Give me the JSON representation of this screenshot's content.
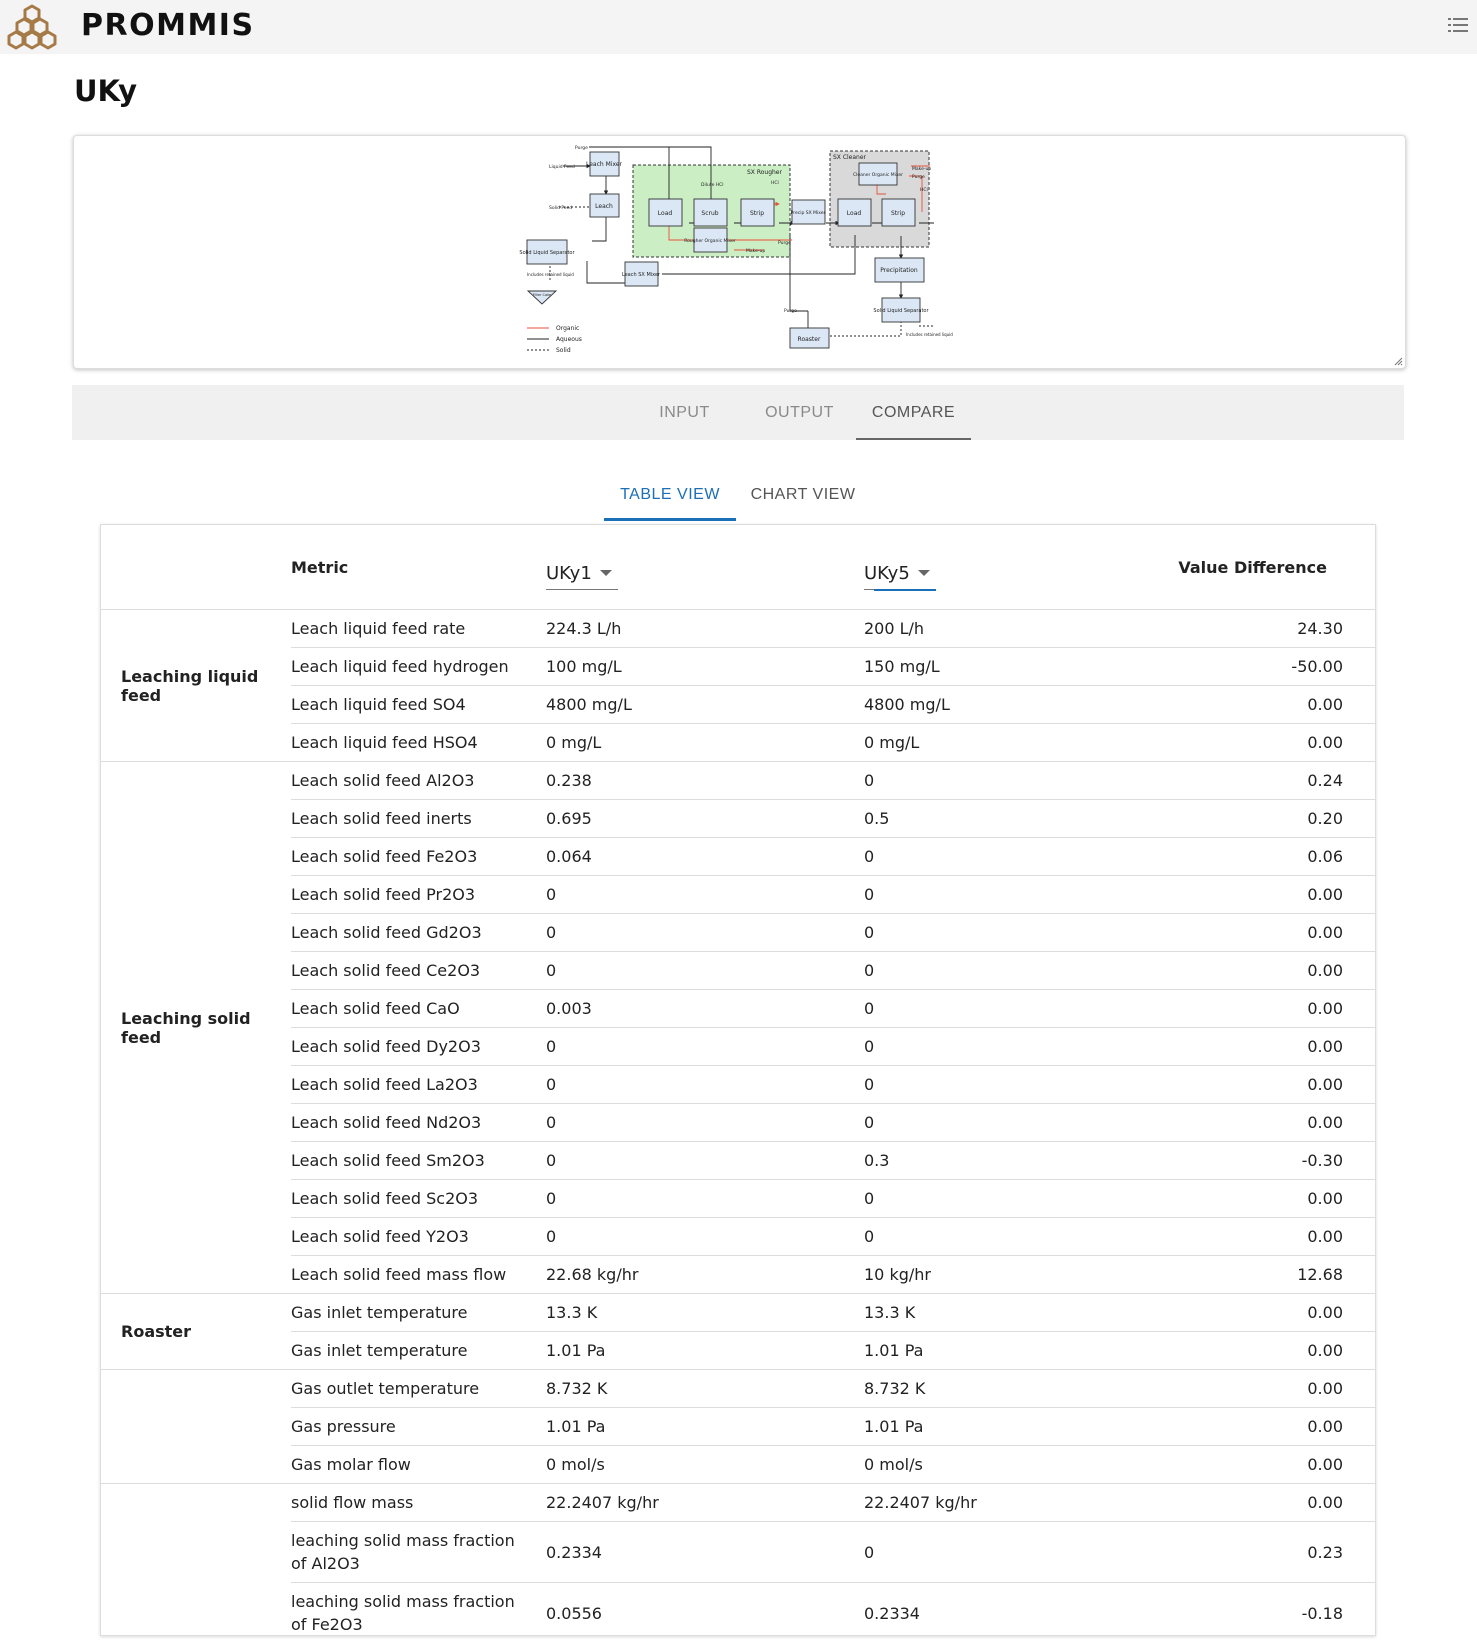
{
  "app": {
    "brand": "PROMMIS"
  },
  "page": {
    "title": "UKy"
  },
  "diagram": {
    "labels": {
      "purge": "Purge",
      "liquid_feed": "Liquid Feed",
      "solid_feed": "Solid Feed",
      "leach_mixer": "Leach Mixer",
      "leach": "Leach",
      "solid_liquid_separator": "Solid Liquid Separator",
      "includes_retained_liquid": "Includes retained liquid",
      "filter_cake": "Filter Cake",
      "sx_rougher": "SX Rougher",
      "dilute_hcl": "Dilute HCl",
      "hcl": "HCl",
      "load": "Load",
      "scrub": "Scrub",
      "strip": "Strip",
      "rougher_organic_mixer": "Rougher Organic Mixer",
      "makeup": "Make-up",
      "leach_sx_mixer": "Leach SX Mixer",
      "precip_sx_mixer": "Precip SX Mixer",
      "sx_cleaner": "SX Cleaner",
      "cleaner_organic_mixer": "Cleaner Organic Mixer",
      "precipitation": "Precipitation",
      "roaster": "Roaster",
      "legend_organic": "Organic",
      "legend_aqueous": "Aqueous",
      "legend_solid": "Solid"
    },
    "colors": {
      "organic": "#e8513a",
      "aqueous": "#222222",
      "rougher_bg": "#cbeec5",
      "cleaner_bg": "#d9d9d9",
      "unit_fill": "#dbe7f5"
    }
  },
  "tabs": {
    "input": "INPUT",
    "output": "OUTPUT",
    "compare": "COMPARE",
    "active": "COMPARE"
  },
  "view_tabs": {
    "table": "TABLE VIEW",
    "chart": "CHART VIEW",
    "active": "TABLE VIEW"
  },
  "table": {
    "header": {
      "metric": "Metric",
      "left_scenario": "UKy1",
      "right_scenario": "UKy5",
      "diff": "Value Difference"
    },
    "groups": [
      {
        "name": "Leaching liquid feed",
        "rows": [
          {
            "metric": "Leach liquid feed rate",
            "left": "224.3 L/h",
            "right": "200 L/h",
            "diff": "24.30"
          },
          {
            "metric": "Leach liquid feed hydrogen",
            "left": "100 mg/L",
            "right": "150 mg/L",
            "diff": "-50.00"
          },
          {
            "metric": "Leach liquid feed SO4",
            "left": "4800 mg/L",
            "right": "4800 mg/L",
            "diff": "0.00"
          },
          {
            "metric": "Leach liquid feed HSO4",
            "left": "0 mg/L",
            "right": "0 mg/L",
            "diff": "0.00"
          }
        ]
      },
      {
        "name": "Leaching solid feed",
        "rows": [
          {
            "metric": "Leach solid feed Al2O3",
            "left": "0.238",
            "right": "0",
            "diff": "0.24"
          },
          {
            "metric": "Leach solid feed inerts",
            "left": "0.695",
            "right": "0.5",
            "diff": "0.20"
          },
          {
            "metric": "Leach solid feed Fe2O3",
            "left": "0.064",
            "right": "0",
            "diff": "0.06"
          },
          {
            "metric": "Leach solid feed Pr2O3",
            "left": "0",
            "right": "0",
            "diff": "0.00"
          },
          {
            "metric": "Leach solid feed Gd2O3",
            "left": "0",
            "right": "0",
            "diff": "0.00"
          },
          {
            "metric": "Leach solid feed Ce2O3",
            "left": "0",
            "right": "0",
            "diff": "0.00"
          },
          {
            "metric": "Leach solid feed CaO",
            "left": "0.003",
            "right": "0",
            "diff": "0.00"
          },
          {
            "metric": "Leach solid feed Dy2O3",
            "left": "0",
            "right": "0",
            "diff": "0.00"
          },
          {
            "metric": "Leach solid feed La2O3",
            "left": "0",
            "right": "0",
            "diff": "0.00"
          },
          {
            "metric": "Leach solid feed Nd2O3",
            "left": "0",
            "right": "0",
            "diff": "0.00"
          },
          {
            "metric": "Leach solid feed Sm2O3",
            "left": "0",
            "right": "0.3",
            "diff": "-0.30"
          },
          {
            "metric": "Leach solid feed Sc2O3",
            "left": "0",
            "right": "0",
            "diff": "0.00"
          },
          {
            "metric": "Leach solid feed Y2O3",
            "left": "0",
            "right": "0",
            "diff": "0.00"
          },
          {
            "metric": "Leach solid feed mass flow",
            "left": "22.68 kg/hr",
            "right": "10 kg/hr",
            "diff": "12.68"
          }
        ]
      },
      {
        "name": "Roaster",
        "rows": [
          {
            "metric": "Gas inlet temperature",
            "left": "13.3 K",
            "right": "13.3 K",
            "diff": "0.00"
          },
          {
            "metric": "Gas inlet temperature",
            "left": "1.01 Pa",
            "right": "1.01 Pa",
            "diff": "0.00"
          }
        ]
      },
      {
        "name": "",
        "rows": [
          {
            "metric": "Gas outlet temperature",
            "left": "8.732 K",
            "right": "8.732 K",
            "diff": "0.00"
          },
          {
            "metric": "Gas pressure",
            "left": "1.01 Pa",
            "right": "1.01 Pa",
            "diff": "0.00"
          },
          {
            "metric": "Gas molar flow",
            "left": "0 mol/s",
            "right": "0 mol/s",
            "diff": "0.00"
          }
        ]
      },
      {
        "name": "",
        "rows": [
          {
            "metric": "solid flow mass",
            "left": "22.2407 kg/hr",
            "right": "22.2407 kg/hr",
            "diff": "0.00"
          },
          {
            "metric": "leaching solid mass fraction of Al2O3",
            "left": "0.2334",
            "right": "0",
            "diff": "0.23"
          },
          {
            "metric": "leaching solid mass fraction of Fe2O3",
            "left": "0.0556",
            "right": "0.2334",
            "diff": "-0.18"
          }
        ]
      }
    ]
  }
}
